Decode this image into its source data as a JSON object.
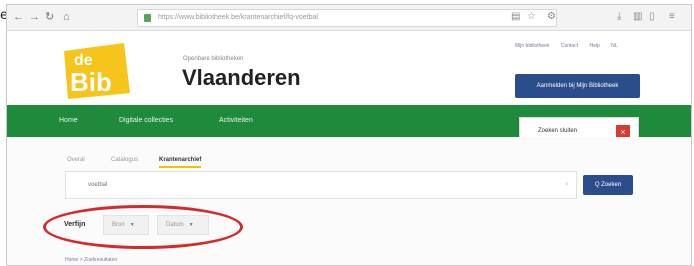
{
  "edge_letter": "e",
  "browser": {
    "url_host": "bibliotheek.be",
    "url_path": "https://www.bibliotheek.be/krantenarchief/fq-voetbal",
    "icons": [
      "back-icon",
      "forward-icon",
      "reload-icon",
      "home-icon",
      "menu-icon",
      "star-icon"
    ]
  },
  "header": {
    "logo_line1": "de",
    "logo_line2": "Bib",
    "subtitle": "Openbare bibliotheken",
    "title": "Vlaanderen",
    "toplinks": [
      "Mijn bibliotheek",
      "Contact",
      "Help",
      "NL"
    ],
    "login_label": "Aanmelden bij Mijn Bibliotheek"
  },
  "nav": {
    "items": [
      "Home",
      "Digitale collecties",
      "Activiteiten"
    ],
    "close_search_label": "Zoeken sluiten",
    "close_icon": "×"
  },
  "search": {
    "tabs": [
      {
        "label": "Overal"
      },
      {
        "label": "Catalogus"
      },
      {
        "label": "Krantenarchief"
      }
    ],
    "input_value": "voetbal",
    "clear_icon": "×",
    "button_label": "Q Zoeken"
  },
  "refine": {
    "label": "Verfijn",
    "dropdowns": [
      {
        "label": "Bron"
      },
      {
        "label": "Datum"
      }
    ],
    "caret": "▼",
    "annotation_color": "#d42a2a"
  },
  "breadcrumb": "Home > Zoekresultaten",
  "colors": {
    "nav_green": "#1f8a3c",
    "brand_blue": "#2b4d8c",
    "logo_yellow": "#f5c51b",
    "close_red": "#d63c2f"
  }
}
